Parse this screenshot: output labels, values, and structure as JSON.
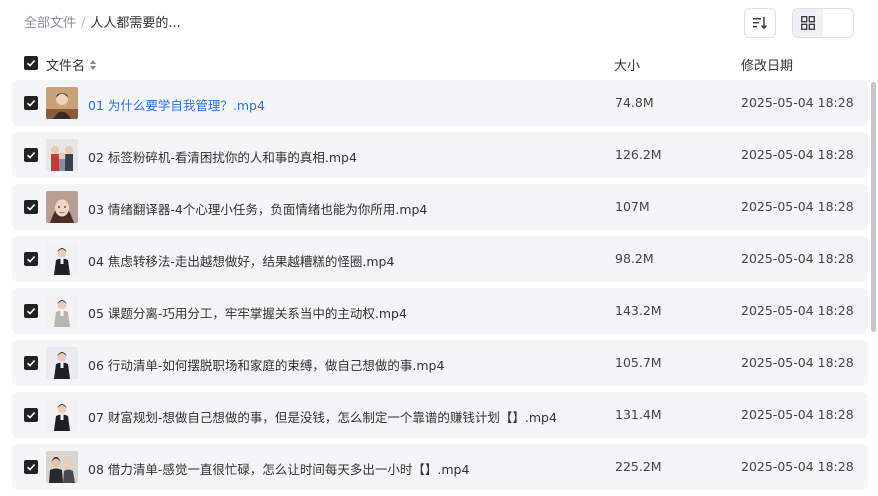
{
  "breadcrumb": {
    "root": "全部文件",
    "separator": "/",
    "current": "人人都需要的..."
  },
  "header": {
    "name": "文件名",
    "size": "大小",
    "date": "修改日期"
  },
  "files": [
    {
      "name": "01 为什么要学自我管理？.mp4",
      "size": "74.8M",
      "date": "2025-05-04 18:28",
      "thumb": "warm"
    },
    {
      "name": "02 标签粉碎机-看清困扰你的人和事的真相.mp4",
      "size": "126.2M",
      "date": "2025-05-04 18:28",
      "thumb": "group"
    },
    {
      "name": "03 情绪翻译器-4个心理小任务，负面情绪也能为你所用.mp4",
      "size": "107M",
      "date": "2025-05-04 18:28",
      "thumb": "face"
    },
    {
      "name": "04 焦虑转移法-走出越想做好，结果越糟糕的怪圈.mp4",
      "size": "98.2M",
      "date": "2025-05-04 18:28",
      "thumb": "speaker"
    },
    {
      "name": "05 课题分离-巧用分工，牢牢掌握关系当中的主动权.mp4",
      "size": "143.2M",
      "date": "2025-05-04 18:28",
      "thumb": "speaker"
    },
    {
      "name": "06 行动清单-如何摆脱职场和家庭的束缚，做自己想做的事.mp4",
      "size": "105.7M",
      "date": "2025-05-04 18:28",
      "thumb": "speaker"
    },
    {
      "name": "07 财富规划-想做自己想做的事，但是没钱，怎么制定一个靠谱的赚钱计划【】.mp4",
      "size": "131.4M",
      "date": "2025-05-04 18:28",
      "thumb": "speaker"
    },
    {
      "name": "08 借力清单-感觉一直很忙碌，怎么让时间每天多出一小时【】.mp4",
      "size": "225.2M",
      "date": "2025-05-04 18:28",
      "thumb": "pair"
    }
  ],
  "colors": {
    "accent": "#2f6fe0",
    "row_bg": "#f4f5f7",
    "checkbox": "#222222"
  }
}
